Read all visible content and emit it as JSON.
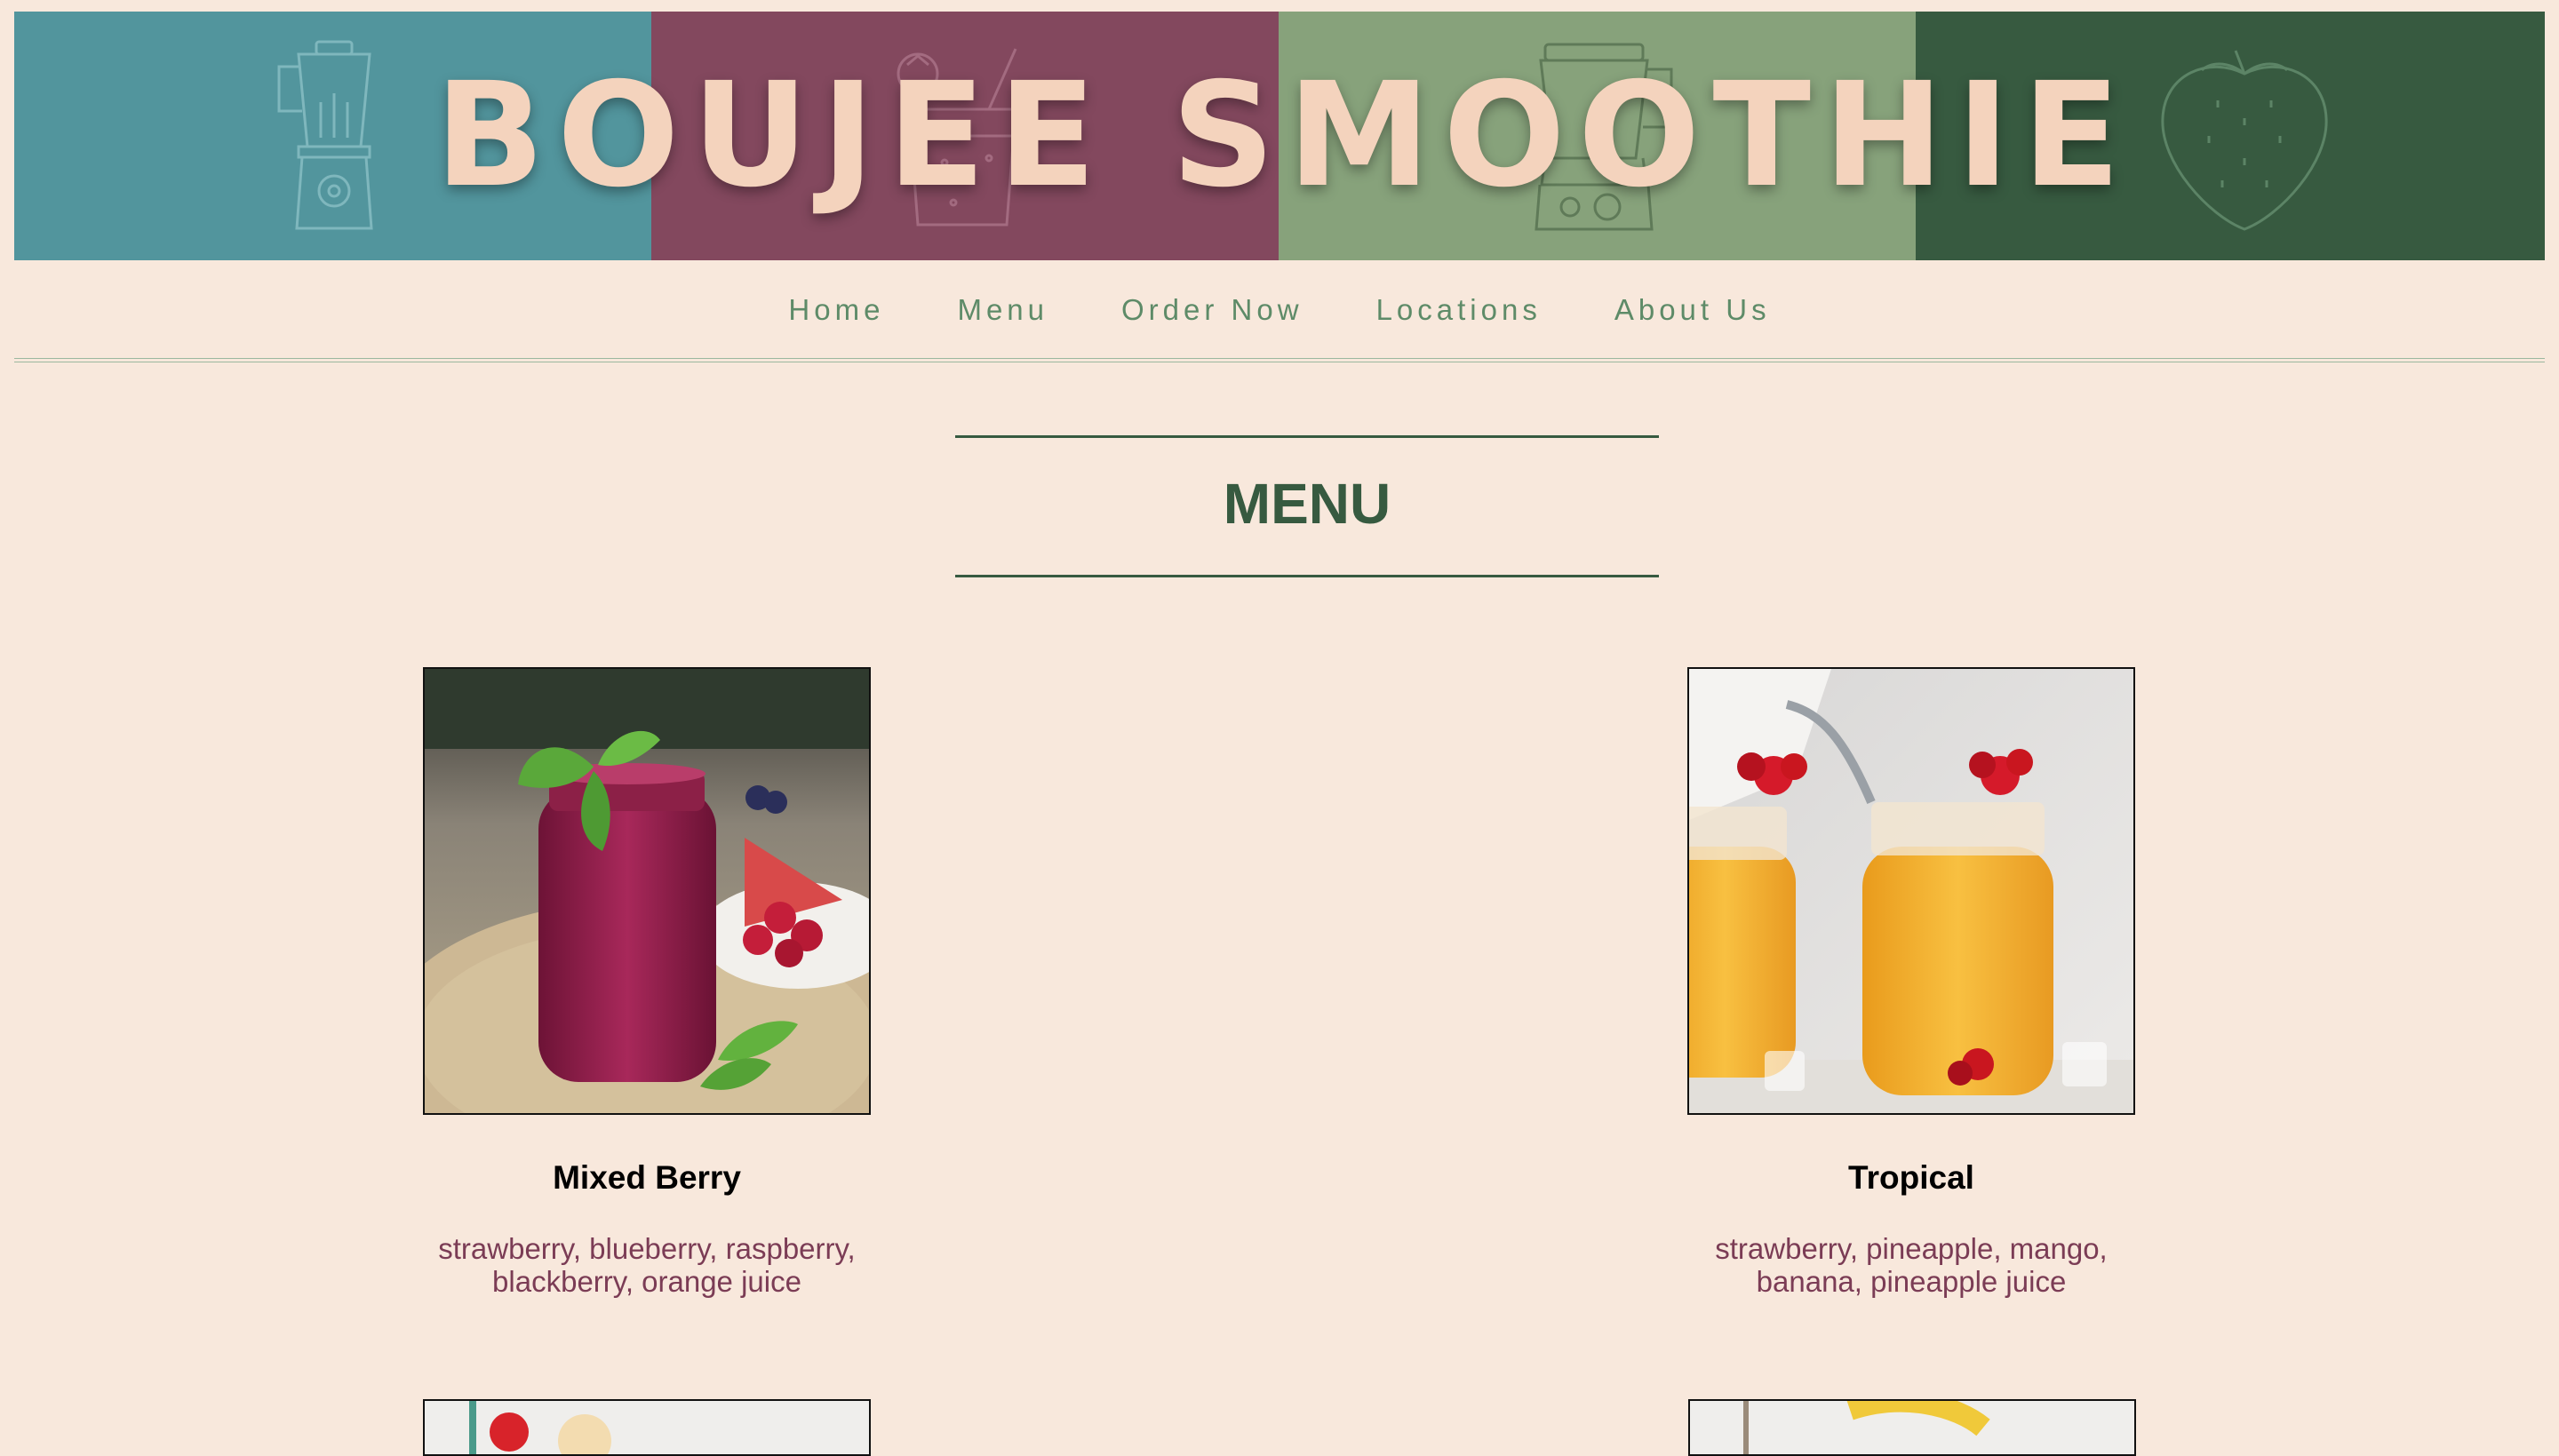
{
  "site": {
    "title": "BOUJEE SMOOTHIE",
    "colors": {
      "background": "#f8e8dc",
      "teal": "#52959d",
      "plum": "#83485e",
      "sage": "#87a27b",
      "forest": "#375a40",
      "title": "#f4d3bd",
      "nav_text": "#5e8b68",
      "description_text": "#7b3c55"
    },
    "banner_icons": [
      "blender-icon",
      "smoothie-glass-icon",
      "blender-icon",
      "strawberry-icon"
    ]
  },
  "nav": {
    "items": [
      {
        "label": "Home"
      },
      {
        "label": "Menu"
      },
      {
        "label": "Order Now"
      },
      {
        "label": "Locations"
      },
      {
        "label": "About Us"
      }
    ]
  },
  "menu": {
    "heading": "MENU",
    "items": [
      {
        "name": "Mixed Berry",
        "description": "strawberry, blueberry, raspberry, blackberry, orange juice",
        "photo": "mixed-berry-smoothie-photo"
      },
      {
        "name": "Tropical",
        "description": "strawberry, pineapple, mango, banana, pineapple juice",
        "photo": "tropical-smoothie-photo"
      }
    ]
  }
}
